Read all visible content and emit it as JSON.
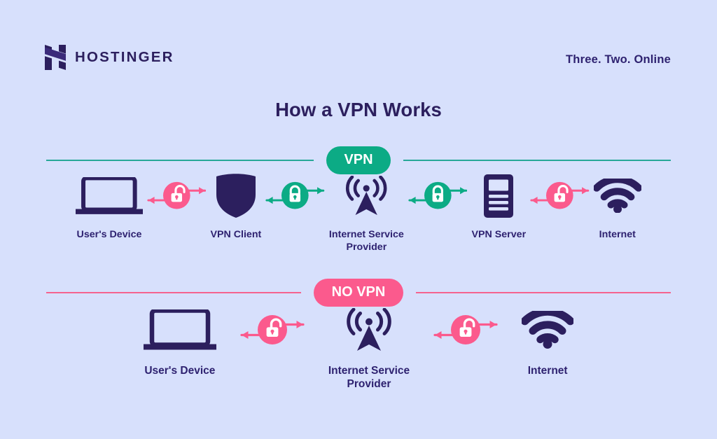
{
  "brand": {
    "name": "HOSTINGER",
    "logo_icon": "hostinger-h-logo"
  },
  "header": {
    "tagline": "Three. Two. Online"
  },
  "title": "How a VPN Works",
  "colors": {
    "background": "#d7e0fc",
    "ink": "#2c1f5e",
    "teal": "#0cab85",
    "teal_rule": "#28a898",
    "pink": "#fb5a8d",
    "pink_rule": "#f5638f"
  },
  "sections": [
    {
      "badge": "VPN",
      "badge_style": "teal",
      "rule_style": "teal",
      "items": [
        {
          "kind": "node",
          "label": "User's Device",
          "icon": "laptop-icon"
        },
        {
          "kind": "connector",
          "icon": "unlocked-padlock-icon",
          "state": "unlocked",
          "color": "pink"
        },
        {
          "kind": "node",
          "label": "VPN Client",
          "icon": "shield-icon"
        },
        {
          "kind": "connector",
          "icon": "locked-padlock-icon",
          "state": "locked",
          "color": "teal"
        },
        {
          "kind": "node",
          "label": "Internet Service\nProvider",
          "icon": "broadcast-tower-icon"
        },
        {
          "kind": "connector",
          "icon": "locked-padlock-icon",
          "state": "locked",
          "color": "teal"
        },
        {
          "kind": "node",
          "label": "VPN Server",
          "icon": "server-icon"
        },
        {
          "kind": "connector",
          "icon": "unlocked-padlock-icon",
          "state": "unlocked",
          "color": "pink"
        },
        {
          "kind": "node",
          "label": "Internet",
          "icon": "wifi-icon"
        }
      ]
    },
    {
      "badge": "NO VPN",
      "badge_style": "pink",
      "rule_style": "pink",
      "items": [
        {
          "kind": "node",
          "label": "User's Device",
          "icon": "laptop-icon"
        },
        {
          "kind": "connector",
          "icon": "unlocked-padlock-icon",
          "state": "unlocked",
          "color": "pink"
        },
        {
          "kind": "node",
          "label": "Internet Service\nProvider",
          "icon": "broadcast-tower-icon"
        },
        {
          "kind": "connector",
          "icon": "unlocked-padlock-icon",
          "state": "unlocked",
          "color": "pink"
        },
        {
          "kind": "node",
          "label": "Internet",
          "icon": "wifi-icon"
        }
      ]
    }
  ]
}
